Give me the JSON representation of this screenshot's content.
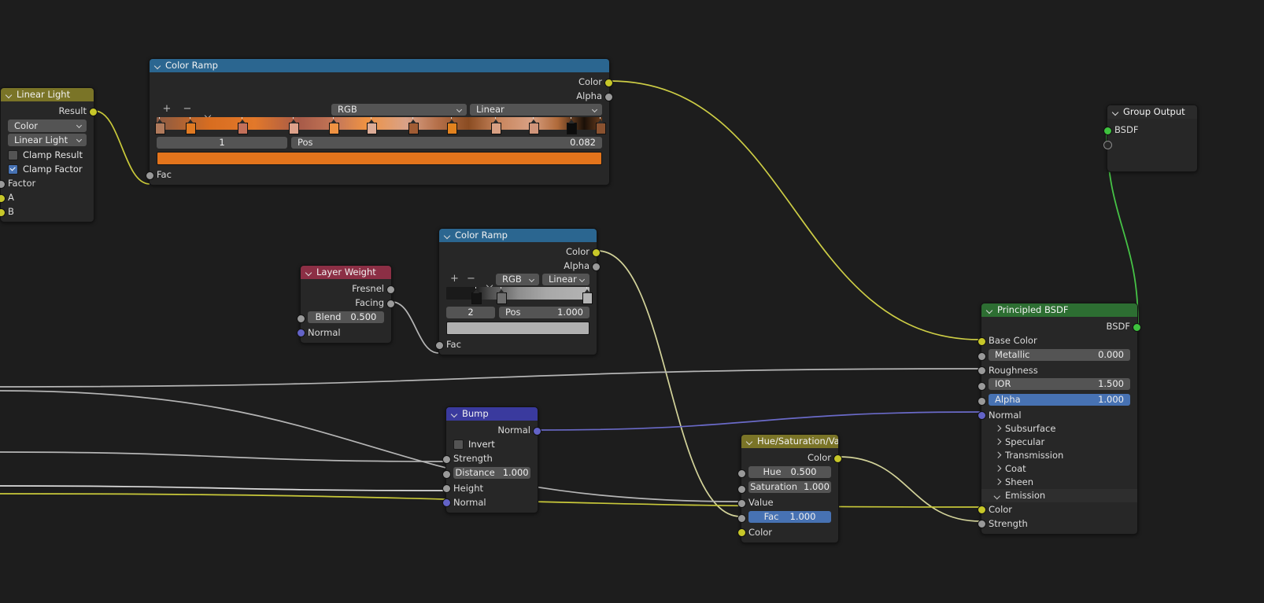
{
  "app": {
    "editor": "Blender Shader Node Editor",
    "background": "#1d1d1d"
  },
  "colors": {
    "header_blue": "#2b6690",
    "header_olive": "#7a7427",
    "header_maroon": "#8c2f45",
    "header_indigo": "#3a3a9e",
    "header_green": "#2d6e32",
    "socket_yellow": "#c7c729",
    "socket_grey": "#9a9a9a",
    "socket_blue": "#6363c7",
    "socket_green": "#3ec23e",
    "field": "#545454",
    "field_selected": "#4772b3",
    "ramp_swatch_1": "#e3741c",
    "ramp_swatch_2": "#b0b0b0"
  },
  "nodes": {
    "linear_light": {
      "title": "Linear Light",
      "outputs": [
        {
          "label": "Result",
          "socket": "yellow"
        }
      ],
      "dropdowns": [
        {
          "name": "data-type",
          "value": "Color"
        },
        {
          "name": "blend-mode",
          "value": "Linear Light"
        }
      ],
      "checkboxes": [
        {
          "label": "Clamp Result",
          "checked": false
        },
        {
          "label": "Clamp Factor",
          "checked": true
        }
      ],
      "inputs": [
        {
          "label": "Factor",
          "socket": "grey"
        },
        {
          "label": "A",
          "socket": "yellow"
        },
        {
          "label": "B",
          "socket": "yellow"
        }
      ]
    },
    "color_ramp_1": {
      "title": "Color Ramp",
      "outputs": [
        {
          "label": "Color",
          "socket": "yellow"
        },
        {
          "label": "Alpha",
          "socket": "grey"
        }
      ],
      "tools": {
        "add": "+",
        "remove": "−",
        "menu": "chevron-down"
      },
      "interpolation_color_mode": "RGB",
      "interpolation": "Linear",
      "index": "1",
      "pos_label": "Pos",
      "pos_value": "0.082",
      "swatch": "#e3741c",
      "gradient_css": "linear-gradient(to right,#8a5a44 0%,#d86d20 12%,#e2782a 22%,#a75a48 32%,#c87a58 41%,#ef9242 47%,#d9a288 56%,#b5704a 63%,#8a4c22 70%,#c8865e 77%,#d8a083 84%,#b06a3a 90%,#1a1008 96%,#6d3f1e 100%)",
      "stops": [
        {
          "pos": 0.5,
          "color": "#b07a5c"
        },
        {
          "pos": 7.5,
          "color": "#e07a22"
        },
        {
          "pos": 19.0,
          "color": "#c2705a"
        },
        {
          "pos": 30.5,
          "color": "#dda18a"
        },
        {
          "pos": 39.5,
          "color": "#ef9242"
        },
        {
          "pos": 48.0,
          "color": "#dcac97"
        },
        {
          "pos": 57.5,
          "color": "#a05c34"
        },
        {
          "pos": 66.0,
          "color": "#e2821e"
        },
        {
          "pos": 76.0,
          "color": "#d8a083"
        },
        {
          "pos": 84.5,
          "color": "#d0957a"
        },
        {
          "pos": 93.0,
          "color": "#0c0c0c"
        },
        {
          "pos": 99.5,
          "color": "#8a5230"
        }
      ],
      "inputs": [
        {
          "label": "Fac",
          "socket": "grey"
        }
      ]
    },
    "layer_weight": {
      "title": "Layer Weight",
      "outputs": [
        {
          "label": "Fresnel",
          "socket": "grey"
        },
        {
          "label": "Facing",
          "socket": "grey"
        }
      ],
      "fields": [
        {
          "label": "Blend",
          "value": "0.500",
          "socket": "grey"
        }
      ],
      "inputs": [
        {
          "label": "Normal",
          "socket": "blue"
        }
      ]
    },
    "color_ramp_2": {
      "title": "Color Ramp",
      "outputs": [
        {
          "label": "Color",
          "socket": "yellow"
        },
        {
          "label": "Alpha",
          "socket": "grey"
        }
      ],
      "tools": {
        "add": "+",
        "remove": "−",
        "menu": "chevron-down"
      },
      "interpolation_color_mode": "RGB",
      "interpolation": "Linear",
      "index": "2",
      "pos_label": "Pos",
      "pos_value": "1.000",
      "swatch": "#b0b0b0",
      "gradient_css": "linear-gradient(to right,#1a1a1a 0%,#1a1a1a 20%,#4a4a4a 30%,#8d8d8d 50%,#a8a8a8 70%,#b4b4b4 100%)",
      "stops": [
        {
          "pos": 20.5,
          "color": "#141414"
        },
        {
          "pos": 38.0,
          "color": "#6e6e6e"
        },
        {
          "pos": 98.0,
          "color": "#b4b4b4"
        }
      ],
      "inputs": [
        {
          "label": "Fac",
          "socket": "grey"
        }
      ]
    },
    "bump": {
      "title": "Bump",
      "outputs": [
        {
          "label": "Normal",
          "socket": "blue"
        }
      ],
      "checkboxes": [
        {
          "label": "Invert",
          "checked": false
        }
      ],
      "inputs": [
        {
          "label": "Strength",
          "socket": "grey",
          "type": "socket"
        },
        {
          "label": "Distance",
          "value": "1.000",
          "socket": "grey",
          "type": "field"
        },
        {
          "label": "Height",
          "socket": "grey",
          "type": "socket"
        },
        {
          "label": "Normal",
          "socket": "blue",
          "type": "socket"
        }
      ]
    },
    "hsv": {
      "title": "Hue/Saturation/Value",
      "outputs": [
        {
          "label": "Color",
          "socket": "yellow"
        }
      ],
      "inputs": [
        {
          "label": "Hue",
          "value": "0.500",
          "socket": "grey",
          "type": "field"
        },
        {
          "label": "Saturation",
          "value": "1.000",
          "socket": "grey",
          "type": "field"
        },
        {
          "label": "Value",
          "socket": "grey",
          "type": "socket"
        },
        {
          "label": "Fac",
          "value": "1.000",
          "socket": "grey",
          "type": "field",
          "selected": true
        },
        {
          "label": "Color",
          "socket": "yellow",
          "type": "socket"
        }
      ]
    },
    "principled_bsdf": {
      "title": "Principled BSDF",
      "outputs": [
        {
          "label": "BSDF",
          "socket": "green"
        }
      ],
      "inputs": [
        {
          "label": "Base Color",
          "socket": "yellow",
          "type": "socket"
        },
        {
          "label": "Metallic",
          "value": "0.000",
          "socket": "grey",
          "type": "field"
        },
        {
          "label": "Roughness",
          "socket": "grey",
          "type": "socket"
        },
        {
          "label": "IOR",
          "value": "1.500",
          "socket": "grey",
          "type": "field"
        },
        {
          "label": "Alpha",
          "value": "1.000",
          "socket": "grey",
          "type": "field",
          "selected": true
        },
        {
          "label": "Normal",
          "socket": "blue",
          "type": "socket"
        }
      ],
      "panels": [
        {
          "label": "Subsurface",
          "open": false
        },
        {
          "label": "Specular",
          "open": false
        },
        {
          "label": "Transmission",
          "open": false
        },
        {
          "label": "Coat",
          "open": false
        },
        {
          "label": "Sheen",
          "open": false
        },
        {
          "label": "Emission",
          "open": true
        }
      ],
      "emission_inputs": [
        {
          "label": "Color",
          "socket": "yellow"
        },
        {
          "label": "Strength",
          "socket": "grey"
        }
      ]
    },
    "group_output": {
      "title": "Group Output",
      "inputs": [
        {
          "label": "BSDF",
          "socket": "green"
        },
        {
          "label": "",
          "socket": "hollow"
        }
      ]
    }
  },
  "links": [
    {
      "from": "linear_light.Result",
      "to": "color_ramp_1.Fac",
      "color": "#c9c93a"
    },
    {
      "from": "color_ramp_1.Color",
      "to": "principled_bsdf.Base Color",
      "color": "#cdcd45"
    },
    {
      "from": "layer_weight.Facing",
      "to": "color_ramp_2.Fac",
      "color": "#b5b5b5"
    },
    {
      "from": "color_ramp_2.Color",
      "to": "hsv.Fac",
      "color": "#d3d39a"
    },
    {
      "from": "bump.Normal",
      "to": "principled_bsdf.Normal",
      "color": "#6a6ac8"
    },
    {
      "from": "hsv.Color",
      "to": "principled_bsdf.Emission Strength",
      "color": "#d3d39a"
    },
    {
      "from": "offscreen",
      "to": "principled_bsdf.Roughness",
      "color": "#b5b5b5"
    },
    {
      "from": "offscreen",
      "to": "bump.Strength",
      "color": "#b5b5b5"
    },
    {
      "from": "offscreen",
      "to": "bump.Height",
      "color": "#d8d8d8"
    },
    {
      "from": "offscreen",
      "to": "hsv.Value",
      "color": "#b5b5b5"
    },
    {
      "from": "offscreen",
      "to": "principled_bsdf.Emission Color",
      "color": "#c9c93a"
    },
    {
      "from": "principled_bsdf.BSDF",
      "to": "group_output.BSDF",
      "color": "#46c246"
    }
  ]
}
